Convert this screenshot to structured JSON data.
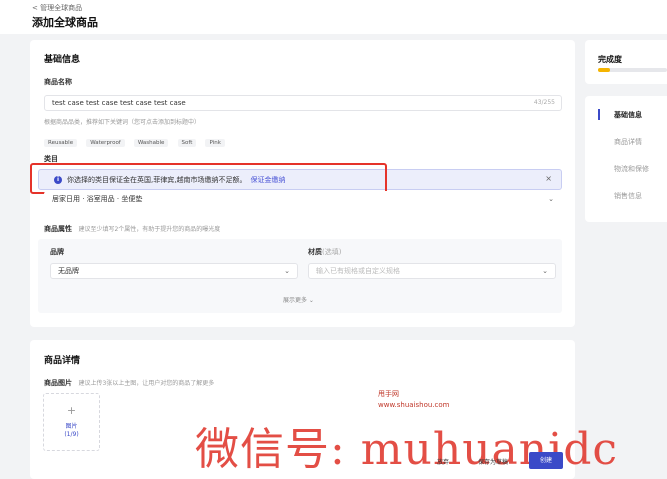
{
  "header": {
    "back_label": "< 管理全球商品",
    "title": "添加全球商品"
  },
  "basic": {
    "section_title": "基础信息",
    "product_name_label": "商品名称",
    "product_name_value": "test  case test  case test  case test  case",
    "char_counter": "43/255",
    "keyword_hint": "根据商品品类，推荐如下关键词（您可点击添加到标题中）",
    "keywords": [
      "Reusable",
      "Waterproof",
      "Washable",
      "Soft",
      "Pink"
    ],
    "category_label": "类目",
    "category_value": "居家日用 · 浴室用品 · 坐便垫",
    "alert_text": "你选择的类目保证金在英国,菲律宾,越南市场缴纳不足额。",
    "alert_link": "保证金缴纳",
    "alert_close": "×",
    "alert_icon": "info-icon",
    "attr_label": "商品属性",
    "attr_hint": "建议至少填写2个属性，有助于提升您的商品的曝光度",
    "brand_label": "品牌",
    "brand_value": "无品牌",
    "material_label": "材质",
    "material_optional": "(选填)",
    "material_placeholder": "输入已有规格或自定义规格",
    "expand_label": "展示更多 ⌄"
  },
  "details": {
    "section_title": "商品详情",
    "images_label": "商品图片",
    "images_hint": "建议上传3张以上主图，让用户对您的商品了解更多",
    "upload_plus": "+",
    "upload_label": "图片",
    "upload_count": "(1/9)"
  },
  "sidebar": {
    "completion_label": "完成度",
    "completion_fraction": 0.18,
    "nav": [
      "基础信息",
      "商品详情",
      "物流和保修",
      "销售信息"
    ],
    "active_index": 0
  },
  "footer": {
    "discard": "放弃",
    "save_draft": "保存为草稿",
    "create": "创建"
  },
  "watermark": {
    "site_name": "甩手网",
    "site_url": "www.shuaishou.com",
    "wechat": "微信号: muhuanidc"
  },
  "colors": {
    "accent": "#3b4ac8",
    "progress": "#f5b400",
    "highlight_box": "#e5332a"
  }
}
